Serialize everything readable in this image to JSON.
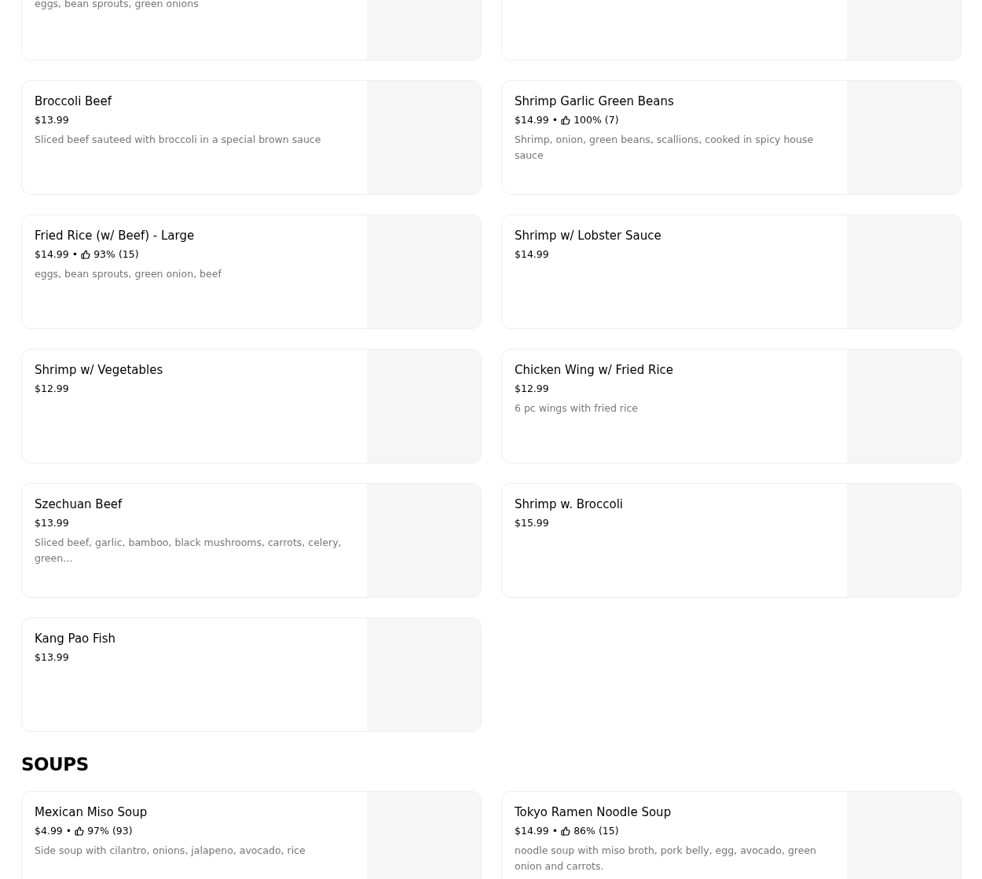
{
  "sections": [
    {
      "items": [
        {
          "kind": "cut",
          "description": "eggs, bean sprouts, green onions"
        },
        {
          "kind": "cut"
        },
        {
          "name": "Broccoli Beef",
          "price": "$13.99",
          "description": "Sliced beef sauteed with broccoli in a special brown sauce"
        },
        {
          "name": "Shrimp Garlic Green Beans",
          "price": "$14.99",
          "separator": "•",
          "rating": "100% (7)",
          "description": "Shrimp, onion, green beans, scallions, cooked in spicy house sauce"
        },
        {
          "name": "Fried Rice (w/ Beef) - Large",
          "price": "$14.99",
          "separator": "•",
          "rating": "93% (15)",
          "description": "eggs, bean sprouts, green onion, beef"
        },
        {
          "name": "Shrimp w/ Lobster Sauce",
          "price": "$14.99"
        },
        {
          "name": "Shrimp w/ Vegetables",
          "price": "$12.99"
        },
        {
          "name": "Chicken Wing w/ Fried Rice",
          "price": "$12.99",
          "description": "6 pc wings with fried rice"
        },
        {
          "name": "Szechuan Beef",
          "price": "$13.99",
          "description": "Sliced beef, garlic, bamboo, black mushrooms, carrots, celery, green…"
        },
        {
          "name": "Shrimp w. Broccoli",
          "price": "$15.99"
        },
        {
          "name": "Kang Pao Fish",
          "price": "$13.99"
        }
      ]
    },
    {
      "title": "SOUPS",
      "items": [
        {
          "name": "Mexican Miso Soup",
          "price": "$4.99",
          "separator": "•",
          "rating": "97% (93)",
          "description": "Side soup with cilantro, onions, jalapeno, avocado, rice"
        },
        {
          "name": "Tokyo Ramen Noodle Soup",
          "price": "$14.99",
          "separator": "•",
          "rating": "86% (15)",
          "description": "noodle soup with miso broth, pork belly, egg, avocado, green onion and carrots."
        }
      ]
    }
  ]
}
